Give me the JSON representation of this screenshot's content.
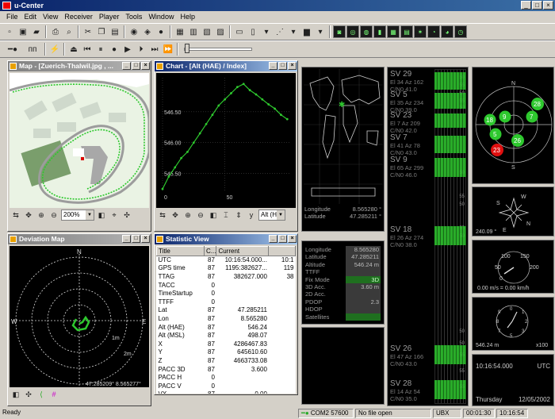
{
  "app": {
    "title": "u-Center"
  },
  "menu": [
    "File",
    "Edit",
    "View",
    "Receiver",
    "Player",
    "Tools",
    "Window",
    "Help"
  ],
  "toolbar": {
    "zoom": "200%"
  },
  "map": {
    "title": "Map - [Zuerich-Thalwil.jpg , ..."
  },
  "chart": {
    "title": "Chart - [Alt (HAE) / Index]",
    "axis_select": "Alt (HA"
  },
  "chart_data": {
    "type": "line",
    "title": "",
    "yticks": [
      "546.50",
      "546.00",
      "545.50"
    ],
    "xticks": [
      "0",
      "50"
    ],
    "x": [
      0,
      5,
      10,
      15,
      20,
      25,
      30,
      35,
      40,
      45,
      50,
      55,
      60,
      65,
      70,
      75,
      80,
      85,
      90,
      95,
      100
    ],
    "y": [
      545.25,
      545.45,
      545.6,
      545.75,
      545.85,
      546.0,
      546.15,
      546.3,
      546.45,
      546.6,
      546.7,
      546.8,
      546.9,
      546.95,
      546.85,
      546.78,
      546.7,
      546.62,
      546.55,
      546.45,
      546.38
    ],
    "ylim": [
      545.2,
      547.05
    ],
    "xlim": [
      0,
      103
    ],
    "color": "#2ec82e"
  },
  "deviation": {
    "title": "Deviation Map",
    "N": "N",
    "S": "S",
    "E": "E",
    "W": "W",
    "r1": "1m",
    "r2": "2m",
    "coords": "47.285209° 8.565277°"
  },
  "statistic": {
    "title": "Statistic View",
    "headers": [
      "Title",
      "C...",
      "Current",
      ""
    ],
    "rows": [
      [
        "UTC",
        "87",
        "10:16:54.000...",
        "10:1"
      ],
      [
        "GPS time",
        "87",
        "1195:382627...",
        "119"
      ],
      [
        "TTAG",
        "87",
        "382627.000",
        "38"
      ],
      [
        "TACC",
        "0",
        "",
        ""
      ],
      [
        "TimeStartup",
        "0",
        "",
        ""
      ],
      [
        "TTFF",
        "0",
        "",
        ""
      ],
      [
        "Lat",
        "87",
        "47.285211",
        ""
      ],
      [
        "Lon",
        "87",
        "8.565280",
        ""
      ],
      [
        "Alt (HAE)",
        "87",
        "546.24",
        ""
      ],
      [
        "Alt (MSL)",
        "87",
        "498.07",
        ""
      ],
      [
        "X",
        "87",
        "4286467.83",
        ""
      ],
      [
        "Y",
        "87",
        "645610.60",
        ""
      ],
      [
        "Z",
        "87",
        "4663733.08",
        ""
      ],
      [
        "PACC 3D",
        "87",
        "3.600",
        ""
      ],
      [
        "PACC H",
        "0",
        "",
        ""
      ],
      [
        "PACC V",
        "0",
        "",
        ""
      ],
      [
        "VX",
        "87",
        "0.00",
        ""
      ]
    ]
  },
  "world": {
    "lon_label": "Longitude",
    "lon": "8.565280 °",
    "lat_label": "Latitude",
    "lat": "47.285211 °"
  },
  "info": [
    [
      "Longitude",
      "8.565280"
    ],
    [
      "Latitude",
      "47.285211"
    ],
    [
      "Altitude",
      "546.24 m"
    ],
    [
      "TTFF",
      ""
    ],
    [
      "Fix Mode",
      "3D"
    ],
    [
      "3D Acc.",
      "3.60 m"
    ],
    [
      "2D Acc.",
      ""
    ],
    [
      "PDOP",
      "2.3"
    ],
    [
      "HDOP",
      ""
    ],
    [
      "Satellites",
      ""
    ]
  ],
  "sv": [
    {
      "name": "SV 29",
      "l1": "El 34 Az 162",
      "l2": "C/N0 41.0"
    },
    {
      "name": "SV 5",
      "l1": "El 35 Az 234",
      "l2": "C/N0 39.0"
    },
    {
      "name": "SV 23",
      "l1": "El 7 Az 209",
      "l2": "C/N0 42.0"
    },
    {
      "name": "SV 7",
      "l1": "El 41 Az 78",
      "l2": "C/N0 43.0"
    },
    {
      "name": "SV 9",
      "l1": "El 65 Az 299",
      "l2": "C/N0 46.0"
    },
    {
      "name": "SV 18",
      "l1": "El 26 Az 274",
      "l2": "C/N0 38.0"
    },
    {
      "name": "SV 26",
      "l1": "El 47 Az 166",
      "l2": "C/N0 43.0"
    },
    {
      "name": "SV 28",
      "l1": "El 14 Az 54",
      "l2": "C/N0 35.0"
    }
  ],
  "db": {
    "top": "55",
    "mid": "50",
    "low": "45",
    "bot": "dB"
  },
  "sky": {
    "sats": [
      "28",
      "18",
      "9",
      "7",
      "5",
      "26",
      "23"
    ],
    "N": "N",
    "S": "S"
  },
  "compass": {
    "value": "240.09 °",
    "N": "N",
    "S": "S",
    "E": "E",
    "W": "W"
  },
  "speed": {
    "label": "0.00 m/s = 0.00 km/h",
    "t1": "100",
    "t2": "150",
    "t3": "50",
    "t4": "0",
    "t5": "200"
  },
  "altmeter": {
    "value": "546.24 m",
    "mult": "x100"
  },
  "clock": {
    "time": "10:16:54.000",
    "tz": "UTC",
    "day": "Thursday",
    "date": "12/05/2002"
  },
  "status": {
    "ready": "Ready",
    "port": "COM2",
    "baud": "57600",
    "file": "No file open",
    "proto": "UBX",
    "t1": "00:01:30",
    "t2": "10:16:54"
  }
}
